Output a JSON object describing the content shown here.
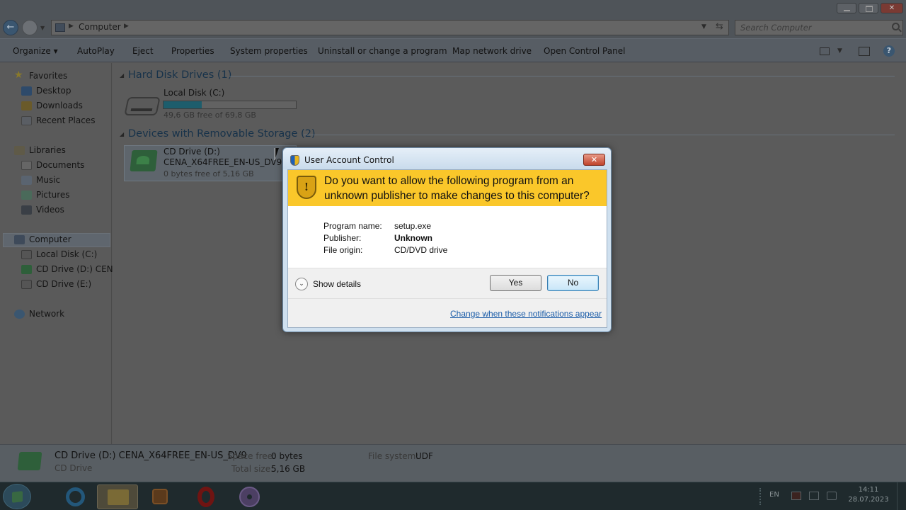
{
  "window": {
    "minimize": "",
    "maximize": "",
    "close": "✕"
  },
  "address": {
    "location": "Computer",
    "search_placeholder": "Search Computer"
  },
  "commands": [
    "Organize ▾",
    "AutoPlay",
    "Eject",
    "Properties",
    "System properties",
    "Uninstall or change a program",
    "Map network drive",
    "Open Control Panel"
  ],
  "nav": {
    "favorites": "Favorites",
    "desktop": "Desktop",
    "downloads": "Downloads",
    "recent": "Recent Places",
    "libraries": "Libraries",
    "documents": "Documents",
    "music": "Music",
    "pictures": "Pictures",
    "videos": "Videos",
    "computer": "Computer",
    "local_disk": "Local Disk (C:)",
    "cd_d": "CD Drive (D:) CENA_",
    "cd_e": "CD Drive (E:)",
    "network": "Network"
  },
  "content": {
    "hdd_group": "Hard Disk Drives (1)",
    "local_disk_name": "Local Disk (C:)",
    "local_disk_free": "49,6 GB free of 69,8 GB",
    "local_disk_used_fraction": 0.29,
    "removable_group": "Devices with Removable Storage (2)",
    "cd_name": "CD Drive (D:)",
    "cd_label": "CENA_X64FREE_EN-US_DV9",
    "cd_free": "0 bytes free of 5,16 GB"
  },
  "details": {
    "title": "CD Drive (D:) CENA_X64FREE_EN-US_DV9",
    "type": "CD Drive",
    "space_free_label": "Space free:",
    "space_free": "0 bytes",
    "total_size_label": "Total size:",
    "total_size": "5,16 GB",
    "fs_label": "File system:",
    "fs": "UDF"
  },
  "taskbar": {
    "lang": "EN",
    "time": "14:11",
    "date": "28.07.2023"
  },
  "uac": {
    "title": "User Account Control",
    "close": "✕",
    "question": "Do you want to allow the following program from an unknown publisher to make changes to this computer?",
    "program_label": "Program name:",
    "program_value": "setup.exe",
    "publisher_label": "Publisher:",
    "publisher_value": "Unknown",
    "origin_label": "File origin:",
    "origin_value": "CD/DVD drive",
    "show_details": "Show details",
    "yes": "Yes",
    "no": "No",
    "change_link": "Change when these notifications appear"
  }
}
